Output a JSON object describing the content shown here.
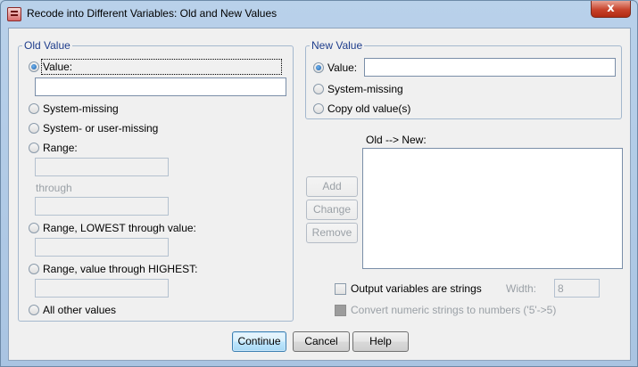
{
  "window": {
    "title": "Recode into Different Variables: Old and New Values",
    "close_glyph": "x"
  },
  "old_value": {
    "legend": "Old Value",
    "value_label": "Value:",
    "value_input": "",
    "system_missing_label": "System-missing",
    "system_user_missing_label": "System- or user-missing",
    "range_label": "Range:",
    "through_label": "through",
    "range_lowest_label": "Range, LOWEST through value:",
    "range_highest_label": "Range, value through HIGHEST:",
    "all_other_label": "All other values",
    "selected": "value"
  },
  "new_value": {
    "legend": "New Value",
    "value_label": "Value:",
    "value_input": "",
    "system_missing_label": "System-missing",
    "copy_old_label": "Copy old value(s)",
    "selected": "value"
  },
  "old_new": {
    "label": "Old --> New:"
  },
  "list_buttons": {
    "add": "Add",
    "change": "Change",
    "remove": "Remove"
  },
  "options": {
    "output_strings_label": "Output variables are strings",
    "width_label": "Width:",
    "width_value": "8",
    "convert_label": "Convert numeric strings to numbers ('5'->5)"
  },
  "footer": {
    "continue": "Continue",
    "cancel": "Cancel",
    "help": "Help"
  }
}
